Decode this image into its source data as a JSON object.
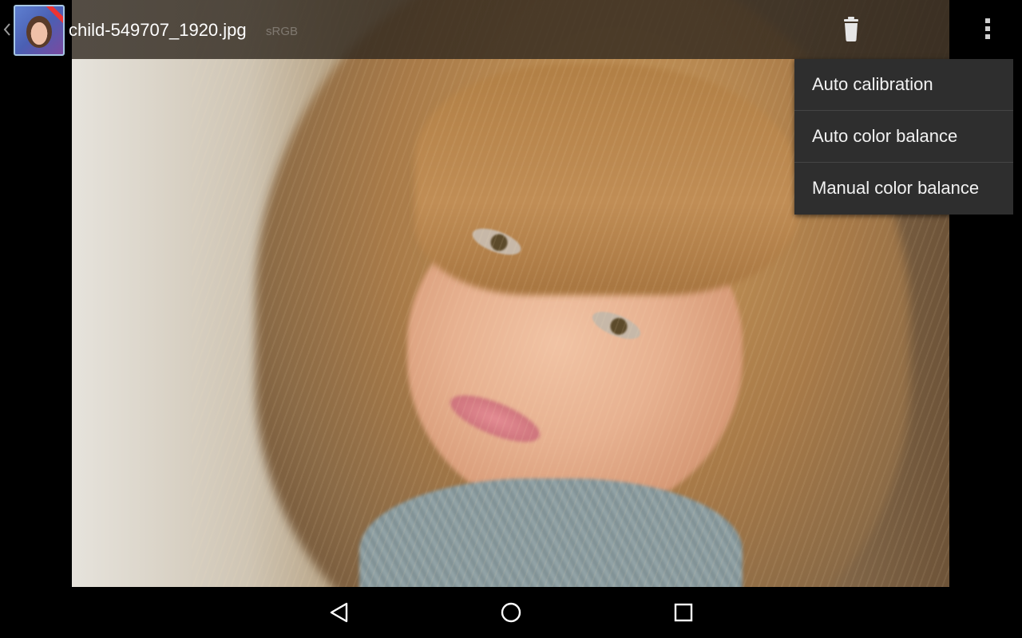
{
  "action_bar": {
    "file_name": "child-549707_1920.jpg",
    "color_profile": "sRGB",
    "icons": {
      "up": "chevron-left-icon",
      "app_thumbnail": "photo-thumbnail-icon",
      "delete": "trash-icon",
      "overflow": "more-vert-icon"
    }
  },
  "overflow_menu": {
    "items": [
      {
        "label": "Auto calibration"
      },
      {
        "label": "Auto color balance"
      },
      {
        "label": "Manual color balance"
      }
    ]
  },
  "navigation_bar": {
    "icons": [
      "back-icon",
      "home-icon",
      "recent-apps-icon"
    ]
  },
  "colors": {
    "menu_background": "#2e2e2e",
    "menu_divider": "#454545",
    "thumbnail_border": "#a7c7e4"
  }
}
